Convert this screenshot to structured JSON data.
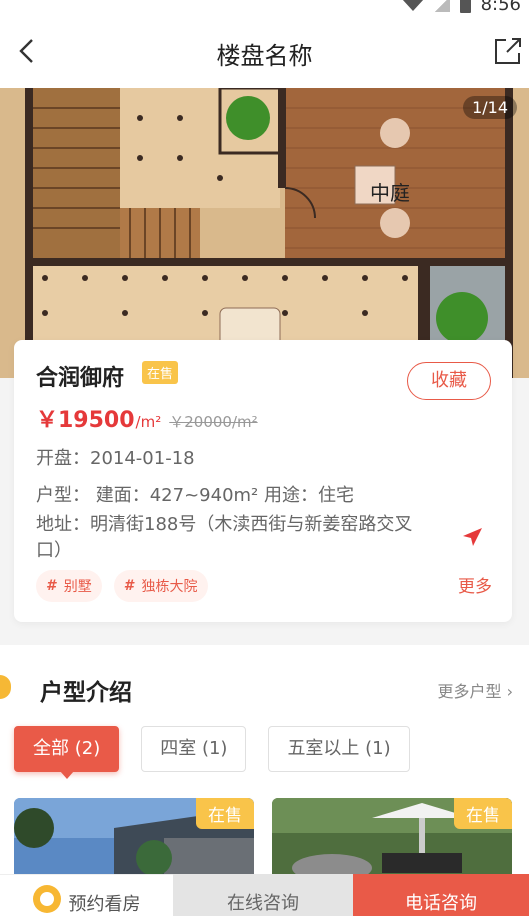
{
  "status_bar": {
    "time": "8:56"
  },
  "nav": {
    "title": "楼盘名称"
  },
  "hero": {
    "counter": "1/14",
    "floorplan_label": "中庭"
  },
  "property": {
    "name": "合润御府",
    "status_tag": "在售",
    "favorite_label": "收藏",
    "price": "￥19500",
    "price_unit": "/m²",
    "old_price": "￥20000/m²",
    "opening": "开盘：2014-01-18",
    "type_info": "户型：  建面：427~940m² 用途：住宅",
    "address": "地址：明清街188号（木渎西街与新姜窑路交叉口）",
    "more_label": "更多",
    "tags": [
      {
        "label": "别墅"
      },
      {
        "label": "独栋大院"
      }
    ]
  },
  "section": {
    "title": "户型介绍",
    "more_label": "更多户型 ›",
    "filters": [
      {
        "label": "全部 (2)",
        "active": true
      },
      {
        "label": "四室 (1)",
        "active": false
      },
      {
        "label": "五室以上 (1)",
        "active": false
      }
    ],
    "units": [
      {
        "status": "在售"
      },
      {
        "status": "在售"
      }
    ]
  },
  "bottom_bar": {
    "appointment": "预约看房",
    "online": "在线咨询",
    "phone": "电话咨询"
  },
  "colors": {
    "accent": "#e95a48",
    "price": "#e5393a",
    "status_tag": "#f9c44a"
  }
}
